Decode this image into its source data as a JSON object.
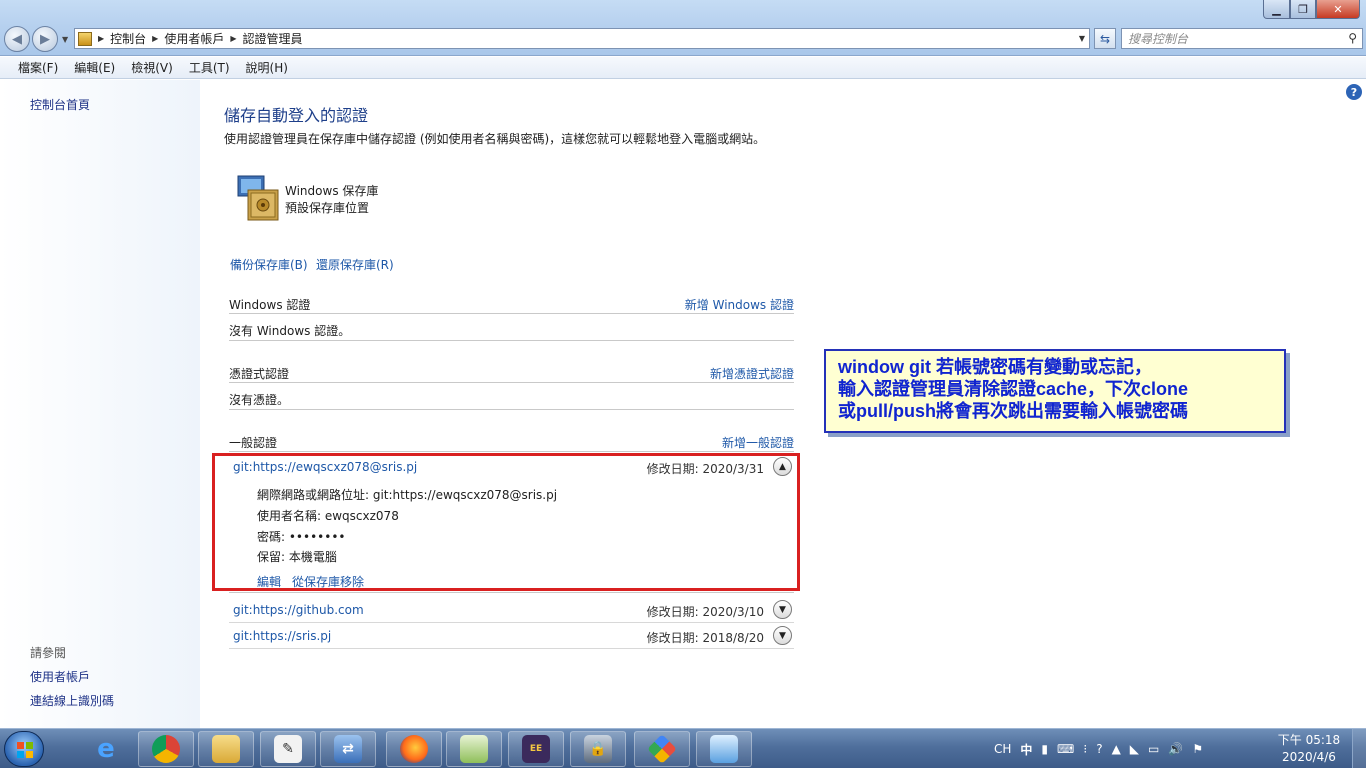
{
  "window": {
    "min_label": "▁",
    "max_label": "❐",
    "close_label": "✕"
  },
  "address": {
    "crumbs": [
      "控制台",
      "使用者帳戶",
      "認證管理員"
    ],
    "search_placeholder": "搜尋控制台"
  },
  "menu": [
    "檔案(F)",
    "編輯(E)",
    "檢視(V)",
    "工具(T)",
    "說明(H)"
  ],
  "sidebar": {
    "home": "控制台首頁",
    "see_also": "請參閱",
    "links": [
      "使用者帳戶",
      "連結線上識別碼"
    ]
  },
  "main": {
    "title": "儲存自動登入的認證",
    "description": "使用認證管理員在保存庫中儲存認證 (例如使用者名稱與密碼)，這樣您就可以輕鬆地登入電腦或網站。",
    "vault_name": "Windows 保存庫",
    "vault_sub": "預設保存庫位置",
    "backup": "備份保存庫(B)",
    "restore": "還原保存庫(R)",
    "sections": {
      "windows": {
        "title": "Windows 認證",
        "add": "新增 Windows 認證",
        "empty": "沒有 Windows 認證。"
      },
      "cert": {
        "title": "憑證式認證",
        "add": "新增憑證式認證",
        "empty": "沒有憑證。"
      },
      "generic": {
        "title": "一般認證",
        "add": "新增一般認證"
      }
    },
    "credentials": [
      {
        "name": "git:https://ewqscxz078@sris.pj",
        "date_label": "修改日期:  2020/3/31",
        "expanded": true,
        "address": "網際網路或網路位址:  git:https://ewqscxz078@sris.pj",
        "username": "使用者名稱:  ewqscxz078",
        "password": "密碼:  ••••••••",
        "persistence": "保留:  本機電腦",
        "edit": "編輯",
        "remove": "從保存庫移除"
      },
      {
        "name": "git:https://github.com",
        "date_label": "修改日期:  2020/3/10",
        "expanded": false
      },
      {
        "name": "git:https://sris.pj",
        "date_label": "修改日期:  2018/8/20",
        "expanded": false
      }
    ]
  },
  "annotation": {
    "lines": [
      "window git  若帳號密碼有變動或忘記，",
      "輸入認證管理員清除認證cache，下次clone",
      "或pull/push將會再次跳出需要輸入帳號密碼"
    ]
  },
  "taskbar": {
    "tray": [
      "CH",
      "中"
    ],
    "time": "下午 05:18",
    "date": "2020/4/6"
  },
  "colors": {
    "link": "#1e58a8",
    "title": "#1e3f8a",
    "highlight_border": "#d92020",
    "annotation_text": "#1024d0",
    "annotation_bg": "#ffffd2"
  }
}
